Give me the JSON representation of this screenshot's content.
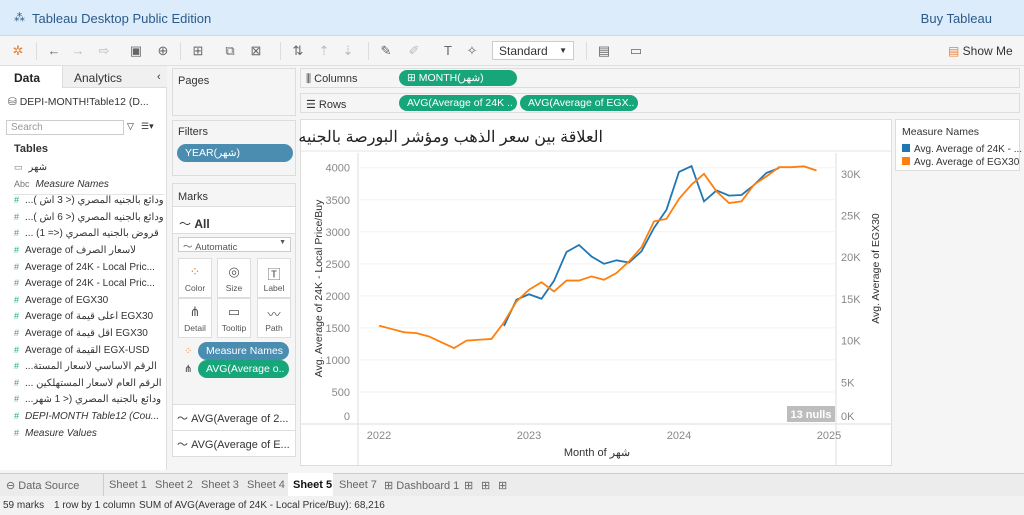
{
  "app": {
    "title": "Tableau Desktop Public Edition",
    "buy": "Buy Tableau"
  },
  "toolbar": {
    "mark_fit": "Standard",
    "show_me": "Show Me"
  },
  "datapane": {
    "tab_data": "Data",
    "tab_analytics": "Analytics",
    "source": "DEPI-MONTH!Table12 (D...",
    "search_placeholder": "Search",
    "tables_label": "Tables",
    "fields": [
      {
        "name": "شهر",
        "type": "date"
      },
      {
        "name": "Measure Names",
        "type": "abc",
        "italic": true
      },
      {
        "name": "...ودائع بالجنيه المصري (< 3 أش )",
        "type": "measure"
      },
      {
        "name": "...ودائع بالجنيه المصري (< 6 أش )",
        "type": "measure"
      },
      {
        "name": "... قروض بالجنيه المصري (<= 1)",
        "type": "measure"
      },
      {
        "name": "Average of  لأسعار الصرف",
        "type": "measure"
      },
      {
        "name": "Average of 24K - Local Pric...",
        "type": "measure"
      },
      {
        "name": "Average of 24K - Local Pric...",
        "type": "measure"
      },
      {
        "name": "Average of EGX30",
        "type": "measure"
      },
      {
        "name": "Average of أعلى قيمة EGX30",
        "type": "measure"
      },
      {
        "name": "Average of أقل قيمة EGX30",
        "type": "measure"
      },
      {
        "name": "Average of القيمة EGX-USD",
        "type": "measure"
      },
      {
        "name": "...الرقم الأساسي لأسعار المستة",
        "type": "measure"
      },
      {
        "name": "... الرقم العام لأسعار المستهلكين",
        "type": "measure"
      },
      {
        "name": "...ودائع بالجنيه المصري (< 1 شهر",
        "type": "measure"
      },
      {
        "name": "DEPI-MONTH Table12 (Cou...",
        "type": "measure",
        "italic": true
      },
      {
        "name": "Measure Values",
        "type": "measure",
        "italic": true
      }
    ]
  },
  "pages": {
    "label": "Pages"
  },
  "filters": {
    "label": "Filters",
    "items": [
      "YEAR(شهر)"
    ]
  },
  "marks": {
    "label": "Marks",
    "all": "All",
    "type": "Automatic",
    "buttons": [
      "Color",
      "Size",
      "Label",
      "Detail",
      "Tooltip",
      "Path"
    ],
    "pills": [
      "Measure Names",
      "AVG(Average o.."
    ],
    "sub": [
      "AVG(Average of 2...",
      "AVG(Average of E..."
    ]
  },
  "shelves": {
    "columns_label": "Columns",
    "rows_label": "Rows",
    "columns": [
      "MONTH(شهر)"
    ],
    "rows": [
      "AVG(Average of 24K ..",
      "AVG(Average of EGX.."
    ]
  },
  "legend": {
    "title": "Measure Names",
    "items": [
      {
        "label": "Avg. Average of 24K - ...",
        "color": "#1f77b4"
      },
      {
        "label": "Avg. Average of EGX30",
        "color": "#ff7f0e"
      }
    ]
  },
  "chart_data": {
    "type": "line",
    "title": "العلاقة بين سعر الذهب ومؤشر البورصة بالجنيه",
    "xlabel": "Month of شهر",
    "ylabel_left": "Avg. Average of 24K - Local Price/Buy",
    "ylabel_right": "Avg. Average of EGX30",
    "x_ticks": [
      "2022",
      "2023",
      "2024",
      "2025"
    ],
    "y_left_ticks": [
      "0",
      "500",
      "1000",
      "1500",
      "2000",
      "2500",
      "3000",
      "3500",
      "4000"
    ],
    "y_right_ticks": [
      "0K",
      "5K",
      "10K",
      "15K",
      "20K",
      "25K",
      "30K"
    ],
    "ylim_left": [
      0,
      4230
    ],
    "ylim_right": [
      0,
      32500
    ],
    "grid": true,
    "legend": "right",
    "nulls_label": "13 nulls",
    "series": [
      {
        "name": "Avg. Average of 24K - ...",
        "axis": "left",
        "color": "#1f77b4",
        "start": "2022-11",
        "values": [
          1530,
          1940,
          2025,
          1955,
          2235,
          2685,
          2795,
          2615,
          2500,
          2555,
          2520,
          2695,
          3060,
          3345,
          3935,
          4025,
          3475,
          3645,
          3565,
          3575,
          3730,
          3920,
          3995
        ]
      },
      {
        "name": "Avg. Average of EGX30",
        "axis": "right",
        "color": "#ff7f0e",
        "start": "2022-01",
        "values": [
          11800,
          11400,
          11000,
          10900,
          10500,
          9800,
          9100,
          10000,
          10100,
          10200,
          12200,
          14700,
          16100,
          17000,
          15900,
          17200,
          17200,
          17700,
          17300,
          18100,
          19500,
          21200,
          24300,
          24600,
          27000,
          28700,
          30000,
          27900,
          26500,
          26700,
          28700,
          29700,
          30800,
          30800,
          30900,
          30400
        ]
      }
    ]
  },
  "sheets": {
    "data_source": "Data Source",
    "tabs": [
      "Sheet 1",
      "Sheet 2",
      "Sheet 3",
      "Sheet 4",
      "Sheet 5",
      "Sheet 7",
      "Dashboard 1"
    ],
    "active": "Sheet 5"
  },
  "status": {
    "marks": "59 marks",
    "dims": "1 row by 1 column",
    "sum": "SUM of AVG(Average of 24K - Local Price/Buy): 68,216"
  }
}
